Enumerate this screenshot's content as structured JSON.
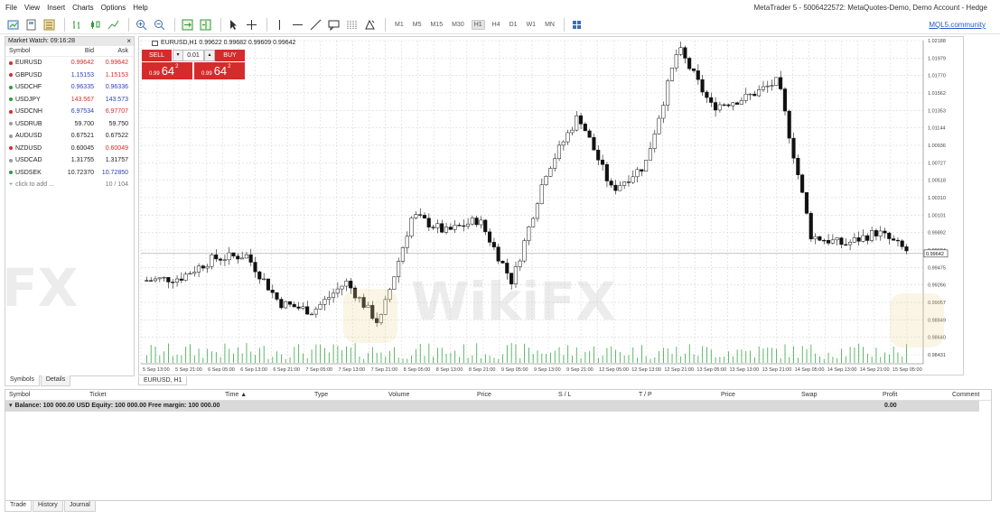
{
  "menu": [
    "File",
    "View",
    "Insert",
    "Charts",
    "Options",
    "Help"
  ],
  "window_title": "MetaTrader 5 - 5006422572: MetaQuotes-Demo, Demo Account - Hedge",
  "toolbar": {
    "timeframes": [
      "M1",
      "M5",
      "M15",
      "M30",
      "H1",
      "H4",
      "D1",
      "W1",
      "MN"
    ],
    "active_timeframe": "H1",
    "community_link": "MQL5.community"
  },
  "market_watch": {
    "title": "Market Watch: 09:16:28",
    "close_label": "×",
    "columns": [
      "Symbol",
      "Bid",
      "Ask"
    ],
    "rows": [
      {
        "symbol": "EURUSD",
        "bid": "0.99642",
        "ask": "0.99642",
        "dot": "#d62b2b",
        "bid_color": "#d62b2b",
        "ask_color": "#d62b2b"
      },
      {
        "symbol": "GBPUSD",
        "bid": "1.15153",
        "ask": "1.15153",
        "dot": "#d62b2b",
        "bid_color": "#2f3fb8",
        "ask_color": "#d62b2b"
      },
      {
        "symbol": "USDCHF",
        "bid": "0.96335",
        "ask": "0.96336",
        "dot": "#2f9a3a",
        "bid_color": "#2f3fb8",
        "ask_color": "#2f3fb8"
      },
      {
        "symbol": "USDJPY",
        "bid": "143.567",
        "ask": "143.573",
        "dot": "#2f9a3a",
        "bid_color": "#d62b2b",
        "ask_color": "#2f3fb8"
      },
      {
        "symbol": "USDCNH",
        "bid": "6.97534",
        "ask": "6.97707",
        "dot": "#d62b2b",
        "bid_color": "#2f3fb8",
        "ask_color": "#d62b2b"
      },
      {
        "symbol": "USDRUB",
        "bid": "59.700",
        "ask": "59.750",
        "dot": "#9a9a9a",
        "bid_color": "#222222",
        "ask_color": "#222222"
      },
      {
        "symbol": "AUDUSD",
        "bid": "0.67521",
        "ask": "0.67522",
        "dot": "#9a9a9a",
        "bid_color": "#222222",
        "ask_color": "#222222"
      },
      {
        "symbol": "NZDUSD",
        "bid": "0.60045",
        "ask": "0.60049",
        "dot": "#d62b2b",
        "bid_color": "#222222",
        "ask_color": "#d62b2b"
      },
      {
        "symbol": "USDCAD",
        "bid": "1.31755",
        "ask": "1.31757",
        "dot": "#9a9a9a",
        "bid_color": "#222222",
        "ask_color": "#222222"
      },
      {
        "symbol": "USDSEK",
        "bid": "10.72370",
        "ask": "10.72850",
        "dot": "#2f9a3a",
        "bid_color": "#222222",
        "ask_color": "#2f3fb8"
      }
    ],
    "add_label": "click to add ...",
    "count": "10 / 104",
    "tabs": [
      "Symbols",
      "Details"
    ]
  },
  "chart": {
    "title": "EURUSD,H1  0.99622 0.99682 0.99609 0.99642",
    "tab_label": "EURUSD, H1",
    "trade_panel": {
      "sell_label": "SELL",
      "buy_label": "BUY",
      "lot": "0.01",
      "bid_small": "0.99",
      "bid_big": "64",
      "bid_sup": "2",
      "ask_small": "0.99",
      "ask_big": "64",
      "ask_sup": "2"
    },
    "price_labels": [
      "1.02188",
      "1.01979",
      "1.01770",
      "1.01562",
      "1.01353",
      "1.01144",
      "1.00936",
      "1.00727",
      "1.00518",
      "1.00310",
      "1.00101",
      "0.99892",
      "0.99684",
      "0.99475",
      "0.99266",
      "0.99057",
      "0.98849",
      "0.98640",
      "0.98431"
    ],
    "current_price": "0.99642",
    "time_labels": [
      "5 Sep 13:00",
      "5 Sep 21:00",
      "6 Sep 05:00",
      "6 Sep 13:00",
      "6 Sep 21:00",
      "7 Sep 05:00",
      "7 Sep 13:00",
      "7 Sep 21:00",
      "8 Sep 05:00",
      "8 Sep 13:00",
      "8 Sep 21:00",
      "9 Sep 05:00",
      "9 Sep 13:00",
      "9 Sep 21:00",
      "12 Sep 05:00",
      "12 Sep 13:00",
      "12 Sep 21:00",
      "13 Sep 05:00",
      "13 Sep 13:00",
      "13 Sep 21:00",
      "14 Sep 05:00",
      "14 Sep 13:00",
      "14 Sep 21:00",
      "15 Sep 05:00"
    ],
    "colors": {
      "bg": "#ffffff",
      "grid": "#d8d8d8",
      "candle": "#111111",
      "volume": "#3aa64a",
      "bid_line": "#a0a0a0"
    }
  },
  "toolbox": {
    "columns": [
      "Symbol",
      "Ticket",
      "Time ▲",
      "Type",
      "Volume",
      "Price",
      "S / L",
      "T / P",
      "Price",
      "Swap",
      "Profit",
      "Comment"
    ],
    "balance_text": "Balance: 100 000.00 USD  Equity: 100 000.00  Free margin: 100 000.00",
    "profit": "0.00",
    "tabs": [
      "Trade",
      "History",
      "Journal"
    ]
  },
  "watermark": "WikiFX"
}
